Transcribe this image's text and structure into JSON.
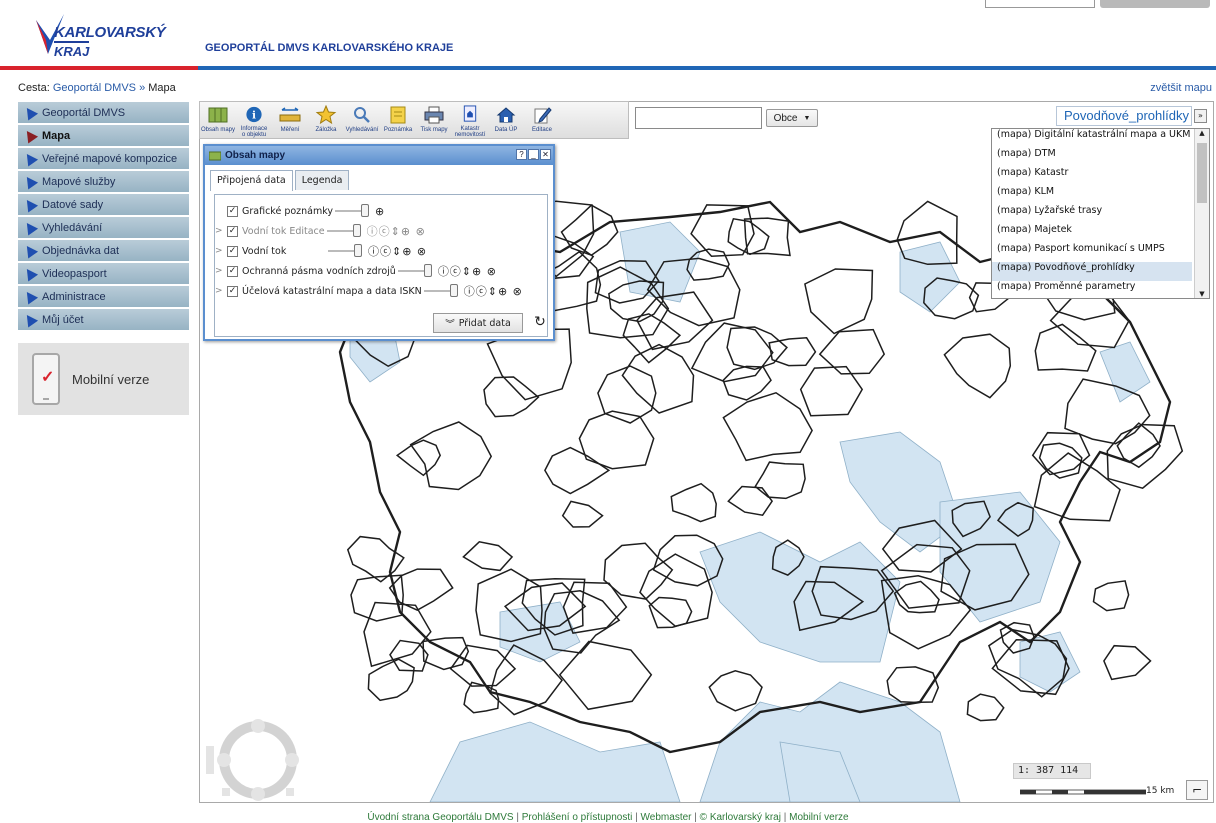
{
  "header": {
    "logo_top": "KARLOVARSKÝ",
    "logo_bottom": "KRAJ",
    "site_title": "GEOPORTÁL DMVS KARLOVARSKÉHO KRAJE"
  },
  "breadcrumb": {
    "prefix": "Cesta:",
    "link": "Geoportál DMVS",
    "separator": "»",
    "current": "Mapa"
  },
  "enlarge_map": "zvětšit mapu",
  "sidebar": {
    "items": [
      {
        "label": "Geoportál DMVS",
        "active": false
      },
      {
        "label": "Mapa",
        "active": true
      },
      {
        "label": "Veřejné mapové kompozice",
        "active": false
      },
      {
        "label": "Mapové služby",
        "active": false
      },
      {
        "label": "Datové sady",
        "active": false
      },
      {
        "label": "Vyhledávání",
        "active": false
      },
      {
        "label": "Objednávka dat",
        "active": false
      },
      {
        "label": "Videopasport",
        "active": false
      },
      {
        "label": "Administrace",
        "active": false
      },
      {
        "label": "Můj účet",
        "active": false
      }
    ],
    "mobile_label": "Mobilní verze"
  },
  "toolbar": {
    "tools": [
      {
        "label1": "Obsah mapy",
        "label2": "",
        "icon": "map-content-icon"
      },
      {
        "label1": "Informace",
        "label2": "o objektu",
        "icon": "info-icon"
      },
      {
        "label1": "Měření",
        "label2": "",
        "icon": "ruler-icon"
      },
      {
        "label1": "Záložka",
        "label2": "",
        "icon": "star-icon"
      },
      {
        "label1": "Vyhledávání",
        "label2": "",
        "icon": "magnifier-icon"
      },
      {
        "label1": "Poznámka",
        "label2": "",
        "icon": "note-icon"
      },
      {
        "label1": "Tisk mapy",
        "label2": "",
        "icon": "printer-icon"
      },
      {
        "label1": "Katastr",
        "label2": "nemovitostí",
        "icon": "cadastre-icon"
      },
      {
        "label1": "Data ÚP",
        "label2": "",
        "icon": "house-icon"
      },
      {
        "label1": "Editace",
        "label2": "",
        "icon": "pencil-icon"
      }
    ]
  },
  "search": {
    "value": "",
    "dropdown_label": "Obce"
  },
  "composition": {
    "selected": "Povodňové_prohlídky",
    "items": [
      "(mapa) Digitální katastrální mapa a ÚKM",
      "(mapa) DTM",
      "(mapa) Katastr",
      "(mapa) KLM",
      "(mapa) Lyžařské trasy",
      "(mapa) Majetek",
      "(mapa) Pasport komunikací s ÚMPS",
      "(mapa) Povodňové_prohlídky",
      "(mapa) Proměnné parametry"
    ],
    "selected_index": 7
  },
  "panel": {
    "title": "Obsah mapy",
    "tabs": [
      "Připojená data",
      "Legenda"
    ],
    "layers": [
      {
        "name": "Grafické poznámky",
        "checked": true,
        "dim": false,
        "expandable": false,
        "icons": "⊕"
      },
      {
        "name": "Vodní tok Editace",
        "checked": true,
        "dim": true,
        "expandable": true,
        "icons": "ⓘⓒ⇕⊕ ⊗"
      },
      {
        "name": "Vodní tok",
        "checked": true,
        "dim": false,
        "expandable": true,
        "icons": "ⓘⓒ⇕⊕ ⊗"
      },
      {
        "name": "Ochranná pásma vodních zdrojů",
        "checked": true,
        "dim": false,
        "expandable": true,
        "icons": "ⓘⓒ⇕⊕ ⊗"
      },
      {
        "name": "Účelová katastrální mapa a data ISKN",
        "checked": true,
        "dim": false,
        "expandable": true,
        "icons": "ⓘⓒ⇕⊕ ⊗"
      }
    ],
    "add_button": "Přidat data",
    "check_glyph": "✓",
    "expand_glyph": ">"
  },
  "map": {
    "scale": "1: 387 114",
    "scale_label": "15 km"
  },
  "footer": {
    "links": [
      "Úvodní strana Geoportálu DMVS",
      "Prohlášení o přístupnosti",
      "Webmaster",
      "© Karlovarský kraj",
      "Mobilní verze"
    ],
    "separator": "|"
  },
  "colors": {
    "accent_blue": "#1f66b6",
    "accent_red": "#d9232d",
    "water_fill": "#d2e4f2"
  }
}
